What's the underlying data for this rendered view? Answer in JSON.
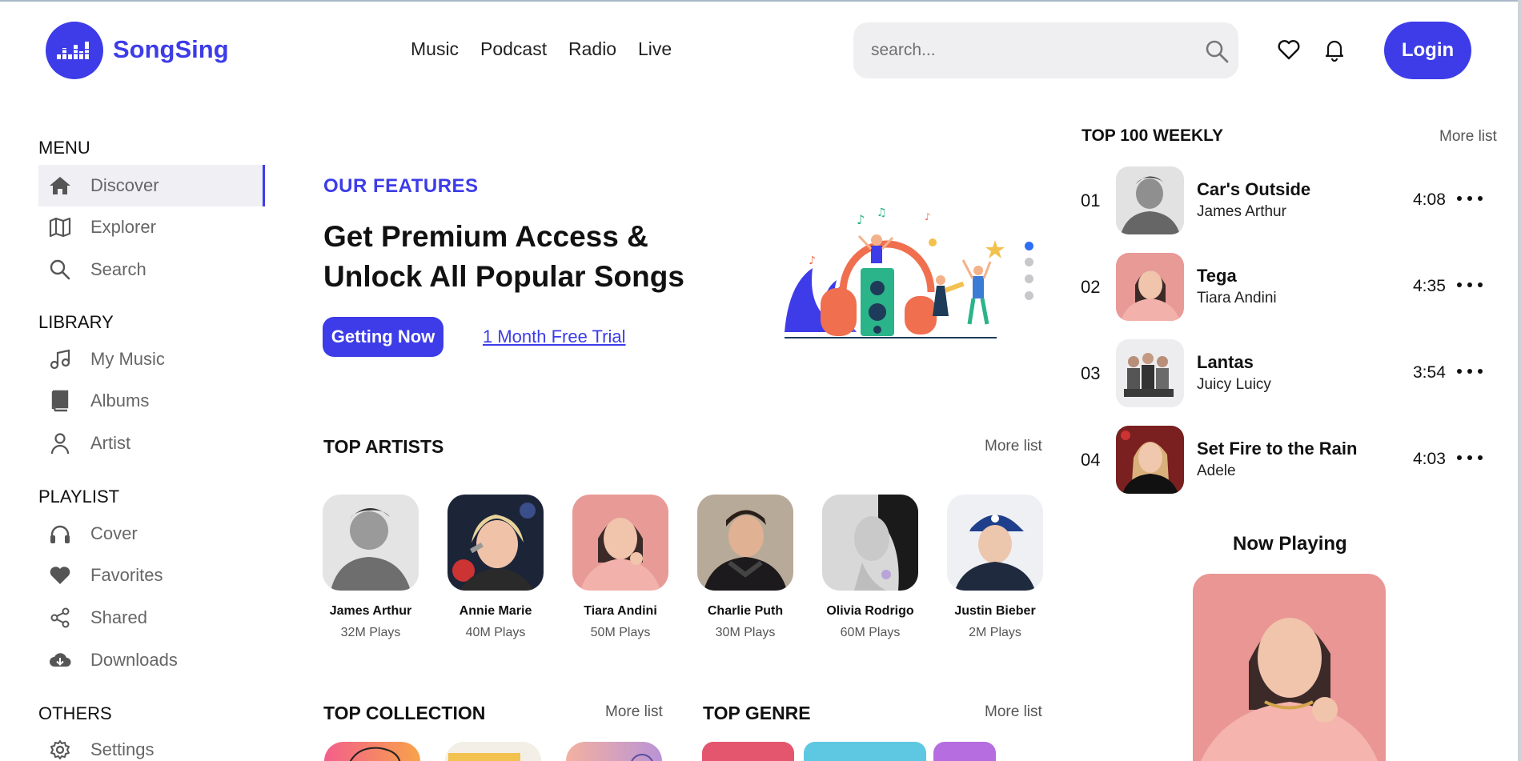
{
  "brand": {
    "name": "SongSing"
  },
  "nav": {
    "items": [
      "Music",
      "Podcast",
      "Radio",
      "Live"
    ]
  },
  "search": {
    "placeholder": "search..."
  },
  "header": {
    "login_label": "Login"
  },
  "sidebar": {
    "menu_heading": "MENU",
    "menu": [
      {
        "label": "Discover",
        "icon": "home-icon",
        "active": true
      },
      {
        "label": "Explorer",
        "icon": "map-icon"
      },
      {
        "label": "Search",
        "icon": "search-icon"
      }
    ],
    "library_heading": "LIBRARY",
    "library": [
      {
        "label": "My Music",
        "icon": "music-note-icon"
      },
      {
        "label": "Albums",
        "icon": "album-book-icon"
      },
      {
        "label": "Artist",
        "icon": "person-icon"
      }
    ],
    "playlist_heading": "PLAYLIST",
    "playlist": [
      {
        "label": "Cover",
        "icon": "headphones-icon"
      },
      {
        "label": "Favorites",
        "icon": "heart-icon"
      },
      {
        "label": "Shared",
        "icon": "share-icon"
      },
      {
        "label": "Downloads",
        "icon": "cloud-download-icon"
      }
    ],
    "others_heading": "OTHERS",
    "others": [
      {
        "label": "Settings",
        "icon": "gear-icon"
      }
    ]
  },
  "feature": {
    "kicker": "OUR FEATURES",
    "title_line1": "Get Premium Access &",
    "title_line2": "Unlock All Popular Songs",
    "cta_label": "Getting Now",
    "trial_label": "1 Month Free Trial",
    "slides_total": 4,
    "slide_active": 1
  },
  "top_artists": {
    "title": "TOP ARTISTS",
    "more": "More list",
    "items": [
      {
        "name": "James Arthur",
        "plays": "32M Plays"
      },
      {
        "name": "Annie Marie",
        "plays": "40M Plays"
      },
      {
        "name": "Tiara Andini",
        "plays": "50M Plays"
      },
      {
        "name": "Charlie Puth",
        "plays": "30M Plays"
      },
      {
        "name": "Olivia Rodrigo",
        "plays": "60M Plays"
      },
      {
        "name": "Justin Bieber",
        "plays": "2M Plays"
      }
    ]
  },
  "top_collection": {
    "title": "TOP COLLECTION",
    "more": "More list"
  },
  "top_genre": {
    "title": "TOP GENRE",
    "more": "More list"
  },
  "top_weekly": {
    "title": "TOP 100 WEEKLY",
    "more": "More list",
    "tracks": [
      {
        "rank": "01",
        "title": "Car's Outside",
        "artist": "James Arthur",
        "duration": "4:08"
      },
      {
        "rank": "02",
        "title": "Tega",
        "artist": "Tiara Andini",
        "duration": "4:35"
      },
      {
        "rank": "03",
        "title": "Lantas",
        "artist": "Juicy Luicy",
        "duration": "3:54"
      },
      {
        "rank": "04",
        "title": "Set Fire to the Rain",
        "artist": "Adele",
        "duration": "4:03"
      }
    ]
  },
  "now_playing": {
    "title": "Now Playing"
  },
  "colors": {
    "accent": "#3d3ce8",
    "active_bg": "#efeff4",
    "dot_active": "#2d6ef5"
  }
}
